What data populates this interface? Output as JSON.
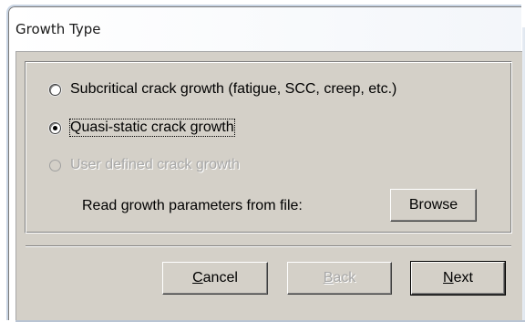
{
  "window": {
    "title": "Growth Type"
  },
  "options": [
    {
      "label": "Subcritical crack growth (fatigue, SCC, creep, etc.)",
      "checked": false,
      "enabled": true
    },
    {
      "label": "Quasi-static crack growth",
      "checked": true,
      "enabled": true
    },
    {
      "label": "User defined crack growth",
      "checked": false,
      "enabled": false
    }
  ],
  "file": {
    "label": "Read growth parameters from file:",
    "browse_label": "Browse"
  },
  "buttons": {
    "cancel_prefix": "C",
    "cancel_rest": "ancel",
    "back_prefix": "B",
    "back_rest": "ack",
    "next_prefix": "N",
    "next_rest": "ext"
  }
}
